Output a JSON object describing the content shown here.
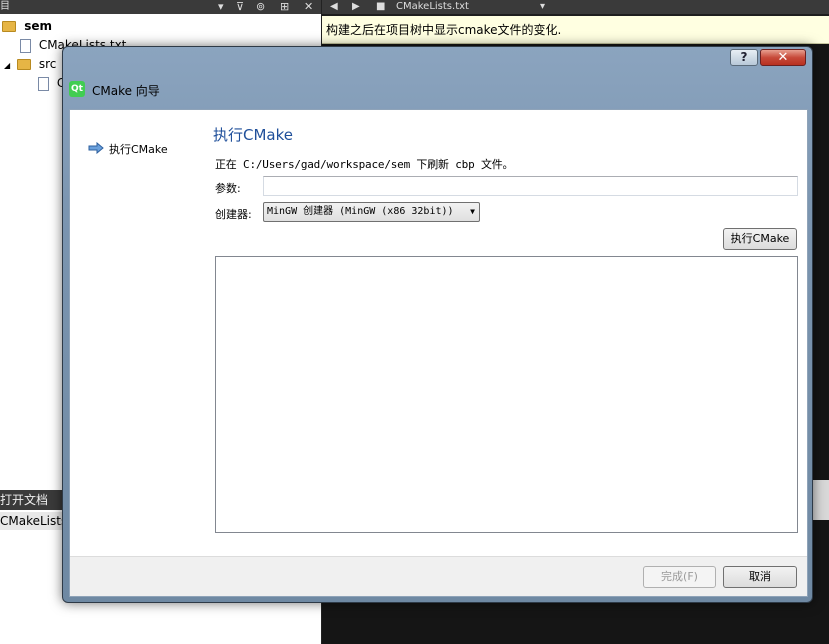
{
  "ide": {
    "project_panel_title": "目",
    "tree": {
      "project": "sem",
      "file_cmakelists": "CMakeLists.txt",
      "folder_src": "src",
      "file_truncated": "C"
    },
    "open_docs_title": "打开文档",
    "open_docs_item": "CMakeLists.txt",
    "editor_tab_title": "CMakeLists.txt",
    "info_bar_text": "构建之后在项目树中显示cmake文件的变化."
  },
  "dialog": {
    "title": "CMake 向导",
    "help_label": "?",
    "close_label": "✕",
    "sidebar_step": "执行CMake",
    "page_title": "执行CMake",
    "status_text": "正在 C:/Users/gad/workspace/sem 下刷新 cbp 文件。",
    "args_label": "参数:",
    "args_value": "",
    "generator_label": "创建器:",
    "generator_value": "MinGW 创建器 (MinGW (x86 32bit))",
    "run_button": "执行CMake",
    "output_text": "",
    "finish_button": "完成(F)",
    "cancel_button": "取消"
  }
}
